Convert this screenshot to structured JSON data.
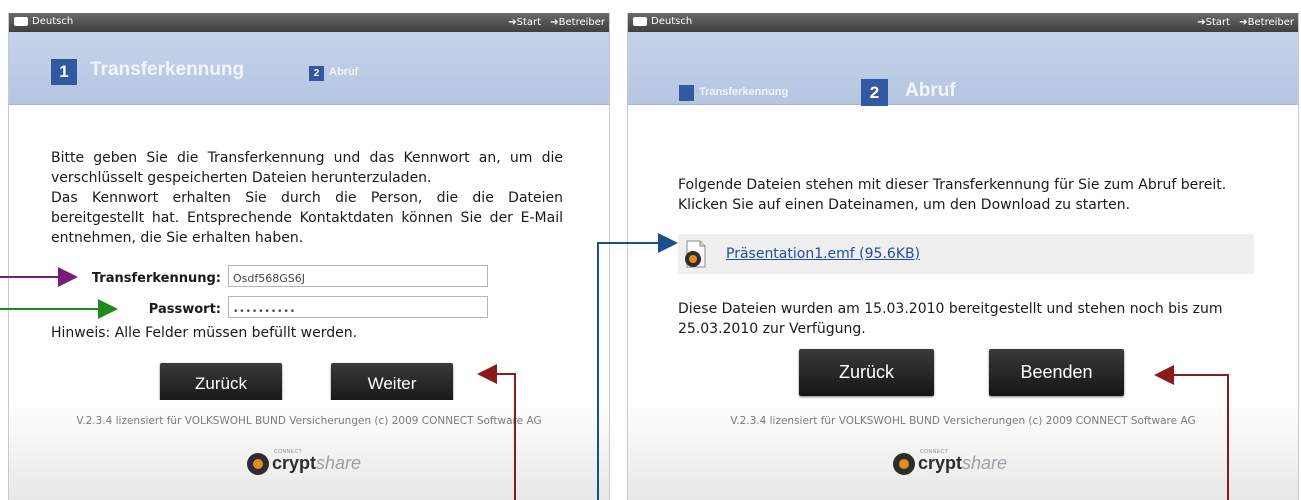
{
  "colors": {
    "header_blue": "#c5d3e9",
    "step_blue": "#3158a0",
    "arrow_purple": "#7a1b7f",
    "arrow_green": "#1f8a1f",
    "arrow_red": "#8b1a1a",
    "arrow_navy": "#1c4f8a"
  },
  "panel_left": {
    "topbar": {
      "lang": "Deutsch",
      "link_start": "➔Start",
      "link_operator": "➔Betreiber"
    },
    "steps": {
      "step1_num": "1",
      "step1_label": "Transferkennung",
      "step2_num": "2",
      "step2_label": "Abruf"
    },
    "intro_p1": "Bitte geben Sie die Transferkennung und das Kennwort an, um die verschlüsselt gespeicherten Dateien herunterzuladen.",
    "intro_p2": "Das Kennwort erhalten Sie durch die Person, die die Dateien bereitgestellt hat. Entsprechende Kontaktdaten können Sie der E-Mail entnehmen, die Sie erhalten haben.",
    "form": {
      "transfer_label": "Transferkennung:",
      "transfer_value": "Osdf568GS6J",
      "password_label": "Passwort:",
      "password_value": "••••••••••",
      "hint": "Hinweis: Alle Felder müssen befüllt werden."
    },
    "buttons": {
      "back": "Zurück",
      "next": "Weiter"
    },
    "footer": {
      "license": "V.2.3.4 lizensiert für VOLKSWOHL BUND Versicherungen (c) 2009 CONNECT Software AG",
      "logo_connect": "CONNECT",
      "logo_crypt": "crypt",
      "logo_share": "share"
    }
  },
  "panel_right": {
    "topbar": {
      "lang": "Deutsch",
      "link_start": "➔Start",
      "link_operator": "➔Betreiber"
    },
    "steps": {
      "step1_num": "1",
      "step1_label": "Transferkennung",
      "step2_num": "2",
      "step2_label": "Abruf"
    },
    "intro": "Folgende Dateien stehen mit dieser Transferkennung für Sie zum Abruf bereit. Klicken Sie auf einen Dateinamen, um den Download zu starten.",
    "file_link": "Präsentation1.emf (95.6KB)",
    "availability": "Diese Dateien wurden am 15.03.2010 bereitgestellt und stehen noch bis zum 25.03.2010 zur Verfügung.",
    "buttons": {
      "back": "Zurück",
      "finish": "Beenden"
    },
    "footer": {
      "license": "V.2.3.4 lizensiert für VOLKSWOHL BUND Versicherungen (c) 2009 CONNECT Software AG",
      "logo_connect": "CONNECT",
      "logo_crypt": "crypt",
      "logo_share": "share"
    }
  }
}
